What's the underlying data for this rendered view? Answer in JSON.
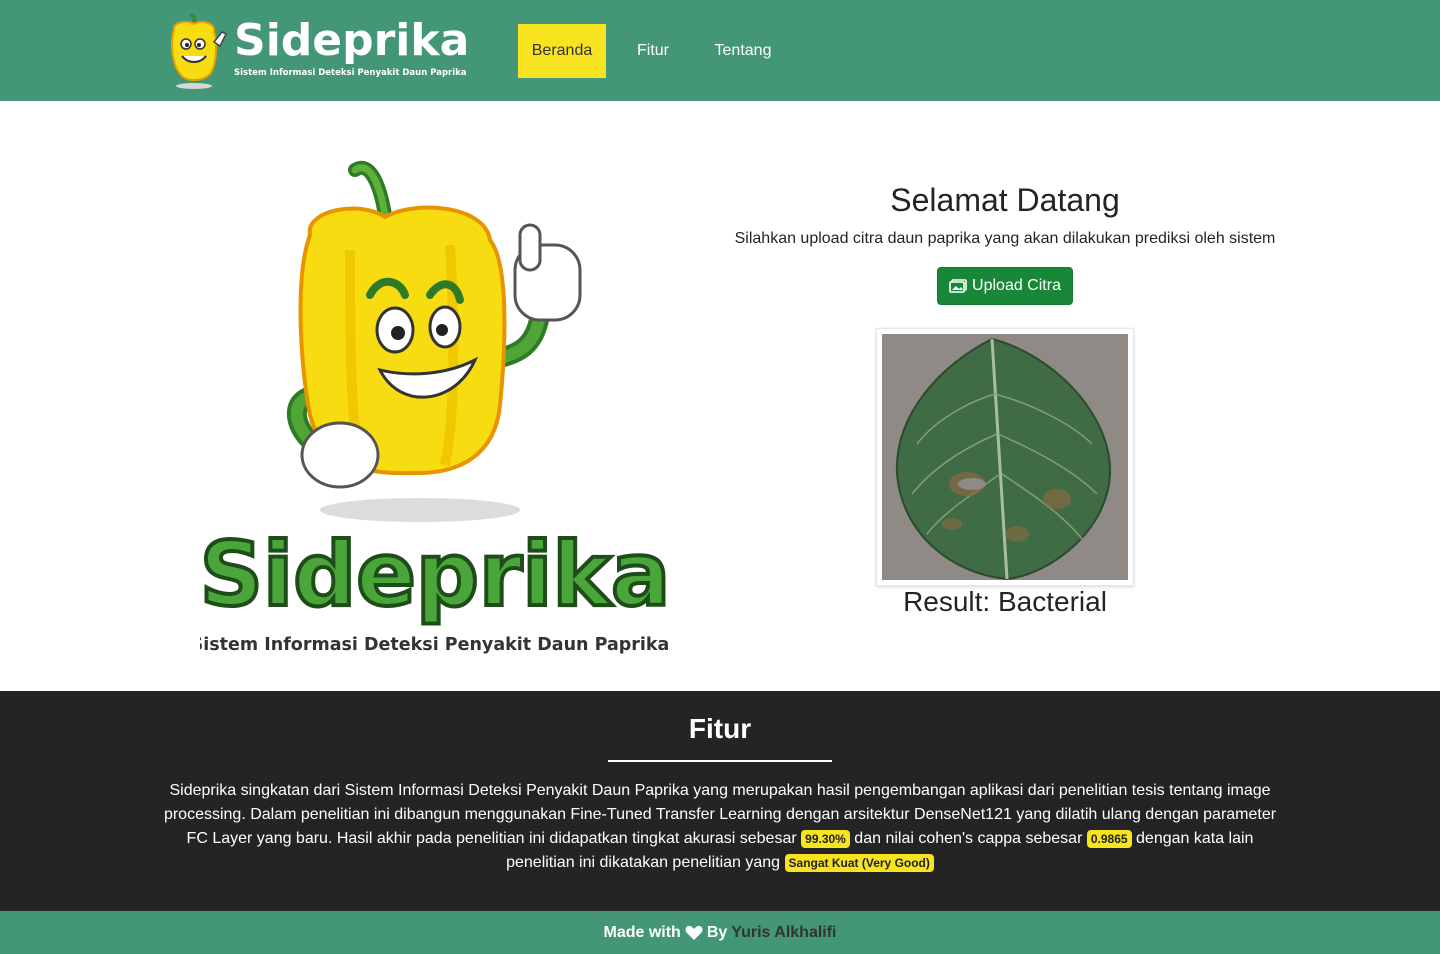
{
  "navbar": {
    "brand_name": "Sideprika",
    "brand_tagline": "Sistem Informasi Deteksi Penyakit Daun Paprika",
    "items": [
      {
        "label": "Beranda",
        "active": true
      },
      {
        "label": "Fitur",
        "active": false
      },
      {
        "label": "Tentang",
        "active": false
      }
    ]
  },
  "hero": {
    "logo_name": "Sideprika",
    "logo_tagline": "Sistem Informasi Deteksi Penyakit Daun Paprika",
    "title": "Selamat Datang",
    "subtitle": "Silahkan upload citra daun paprika yang akan dilakukan prediksi oleh sistem",
    "upload_label": "Upload Citra",
    "result": "Result: Bacterial"
  },
  "fitur": {
    "title": "Fitur",
    "text_1": "Sideprika singkatan dari Sistem Informasi Deteksi Penyakit Daun Paprika yang merupakan hasil pengembangan aplikasi dari penelitian tesis tentang image processing. Dalam penelitian ini dibangun menggunakan Fine-Tuned Transfer Learning dengan arsitektur DenseNet121 yang dilatih ulang dengan parameter FC Layer yang baru. Hasil akhir pada penelitian ini didapatkan tingkat akurasi sebesar",
    "accuracy": "99.30%",
    "text_2": "dan nilai cohen's cappa sebesar",
    "kappa": "0.9865",
    "text_3": "dengan kata lain penelitian ini dikatakan penelitian yang",
    "rating": "Sangat Kuat (Very Good)"
  },
  "footer": {
    "made_with": "Made with",
    "by": "By",
    "author": "Yuris Alkhalifi"
  },
  "colors": {
    "primary_green": "#439776",
    "accent_yellow": "#f8e320",
    "button_green": "#198738",
    "dark_section": "#242424"
  }
}
